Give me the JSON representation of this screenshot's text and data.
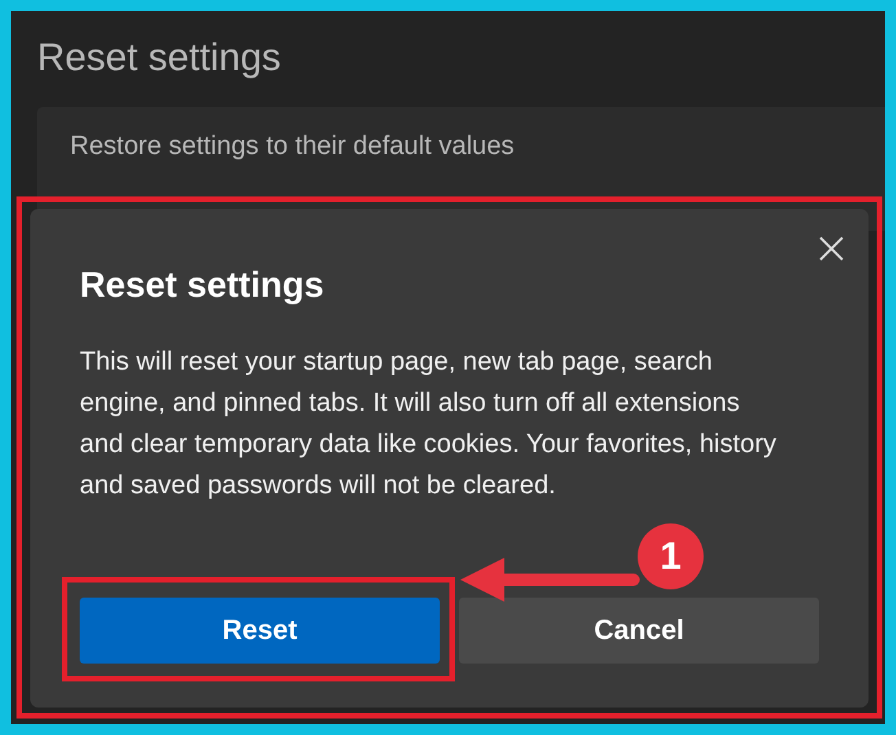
{
  "page": {
    "title": "Reset settings",
    "card_text": "Restore settings to their default values"
  },
  "dialog": {
    "title": "Reset settings",
    "body": "This will reset your startup page, new tab page, search engine, and pinned tabs. It will also turn off all extensions and clear temporary data like cookies. Your favorites, history and saved passwords will not be cleared.",
    "buttons": [
      {
        "label": "Reset",
        "kind": "primary"
      },
      {
        "label": "Cancel",
        "kind": "secondary"
      }
    ]
  },
  "annotation": {
    "badge": "1"
  }
}
